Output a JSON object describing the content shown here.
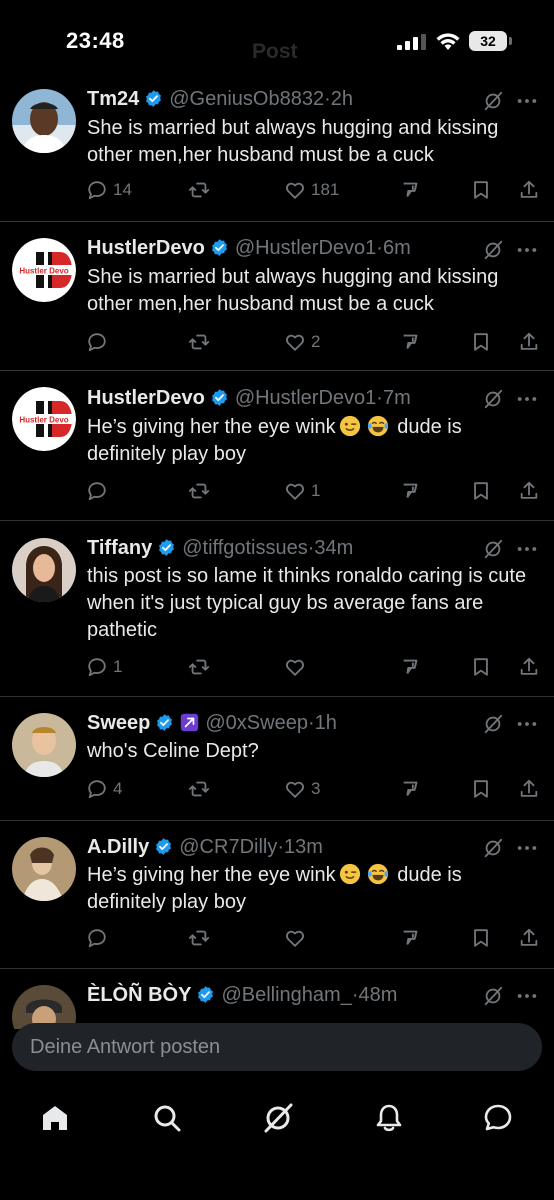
{
  "status_bar": {
    "time": "23:48",
    "ghost_title": "Post",
    "battery": "32"
  },
  "tweets": [
    {
      "name": "Tm24",
      "handle": "@GeniusOb8832",
      "dot": "·",
      "age": "2h",
      "text": "She is married but always hugging and kissing other men,her husband must be a cuck",
      "replies": "14",
      "retweets": "",
      "likes": "181"
    },
    {
      "name": "HustlerDevo",
      "handle": "@HustlerDevo1",
      "dot": "·",
      "age": "6m",
      "text": "She is married but always hugging and kissing other men,her husband must be a cuck",
      "replies": "",
      "retweets": "",
      "likes": "2"
    },
    {
      "name": "HustlerDevo",
      "handle": "@HustlerDevo1",
      "dot": "·",
      "age": "7m",
      "text_before": "He’s giving her the eye wink",
      "text_after": "dude is definitely play boy",
      "replies": "",
      "retweets": "",
      "likes": "1"
    },
    {
      "name": "Tiffany",
      "handle": "@tiffgotissues",
      "dot": "·",
      "age": "34m",
      "text": "this post is so lame it thinks ronaldo caring is cute when it's just typical guy bs average fans are pathetic",
      "replies": "1",
      "retweets": "",
      "likes": ""
    },
    {
      "name": "Sweep",
      "handle": "@0xSweep",
      "dot": "·",
      "age": "1h",
      "text": "who's Celine Dept?",
      "replies": "4",
      "retweets": "",
      "likes": "3"
    },
    {
      "name": "A.Dilly",
      "handle": "@CR7Dilly",
      "dot": "·",
      "age": "13m",
      "text_before": "He’s giving her the eye wink",
      "text_after": "dude is definitely play boy",
      "replies": "",
      "retweets": "",
      "likes": ""
    },
    {
      "name": "ÈLÒÑ BÒY",
      "handle": "@Bellingham_",
      "dot": "·",
      "age": "48m"
    }
  ],
  "avatar_text": {
    "hustler_logo": "Hustler Devo"
  },
  "reply": {
    "placeholder": "Deine Antwort posten"
  },
  "colors": {
    "background": "#000000",
    "text": "#e7e9ea",
    "muted": "#71767b",
    "verified": "#1d9bf0",
    "divider": "#2f3336",
    "reply_bar": "#202327"
  },
  "icons": [
    "verified-badge-icon",
    "grok-icon",
    "more-icon",
    "reply-icon",
    "retweet-icon",
    "like-icon",
    "stats-icon",
    "bookmark-icon",
    "share-icon",
    "home-icon",
    "search-icon",
    "grok-nav-icon",
    "notifications-icon",
    "messages-icon"
  ]
}
